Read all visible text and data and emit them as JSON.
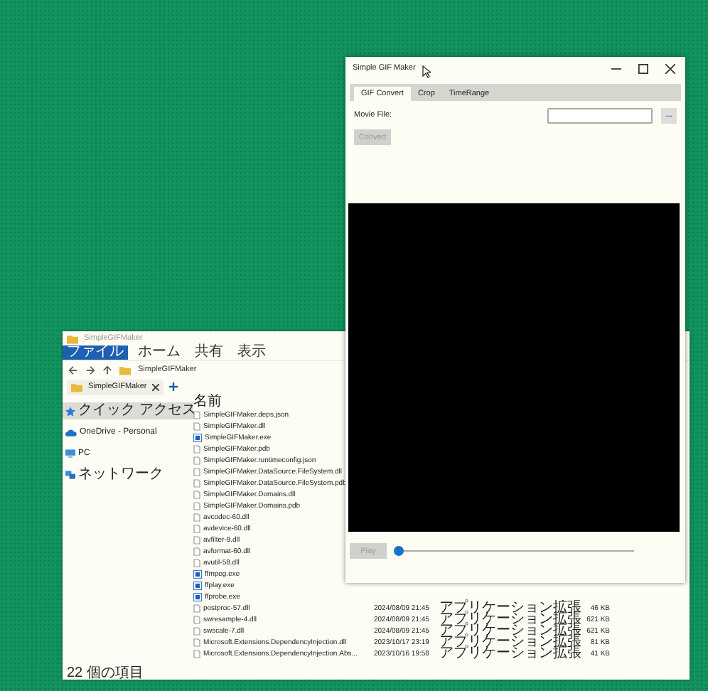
{
  "explorer": {
    "title": "SimpleGIFMaker",
    "ribbon_tabs": [
      {
        "label": "ファイル",
        "selected": true
      },
      {
        "label": "ホーム",
        "selected": false
      },
      {
        "label": "共有",
        "selected": false
      },
      {
        "label": "表示",
        "selected": false
      }
    ],
    "breadcrumb": "SimpleGIFMaker",
    "tab": "SimpleGIFMaker",
    "nav_items": [
      {
        "label": "クイック アクセス",
        "kind": "star",
        "selected": true
      },
      {
        "label": "OneDrive - Personal",
        "kind": "cloud",
        "selected": false
      },
      {
        "label": "PC",
        "kind": "pc",
        "selected": false
      },
      {
        "label": "ネットワーク",
        "kind": "network",
        "selected": false
      }
    ],
    "column_name": "名前",
    "files": [
      {
        "name": "SimpleGIFMaker.deps.json",
        "kind": "file"
      },
      {
        "name": "SimpleGIFMaker.dll",
        "kind": "file"
      },
      {
        "name": "SimpleGIFMaker.exe",
        "kind": "exe"
      },
      {
        "name": "SimpleGIFMaker.pdb",
        "kind": "file"
      },
      {
        "name": "SimpleGIFMaker.runtimeconfig.json",
        "kind": "file"
      },
      {
        "name": "SimpleGIFMaker.DataSource.FileSystem.dll",
        "kind": "file"
      },
      {
        "name": "SimpleGIFMaker.DataSource.FileSystem.pdb",
        "kind": "file"
      },
      {
        "name": "SimpleGIFMaker.Domains.dll",
        "kind": "file"
      },
      {
        "name": "SimpleGIFMaker.Domains.pdb",
        "kind": "file"
      },
      {
        "name": "avcodec-60.dll",
        "kind": "file"
      },
      {
        "name": "avdevice-60.dll",
        "kind": "file"
      },
      {
        "name": "avfilter-9.dll",
        "kind": "file"
      },
      {
        "name": "avformat-60.dll",
        "kind": "file"
      },
      {
        "name": "avutil-58.dll",
        "kind": "file"
      },
      {
        "name": "ffmpeg.exe",
        "kind": "exe"
      },
      {
        "name": "ffplay.exe",
        "kind": "exe"
      },
      {
        "name": "ffprobe.exe",
        "kind": "exe"
      },
      {
        "name": "postproc-57.dll",
        "kind": "file",
        "date": "2024/08/09 21:45",
        "type": "アプリケーション拡張",
        "size": "46 KB"
      },
      {
        "name": "swresample-4.dll",
        "kind": "file",
        "date": "2024/08/09 21:45",
        "type": "アプリケーション拡張",
        "size": "621 KB"
      },
      {
        "name": "swscale-7.dll",
        "kind": "file",
        "date": "2024/08/09 21:45",
        "type": "アプリケーション拡張",
        "size": "621 KB"
      },
      {
        "name": "Microsoft.Extensions.DependencyInjection.dll",
        "kind": "file",
        "date": "2023/10/17 23:19",
        "type": "アプリケーション拡張",
        "size": "81 KB"
      },
      {
        "name": "Microsoft.Extensions.DependencyInjection.Abs...",
        "kind": "file",
        "date": "2023/10/16 19:58",
        "type": "アプリケーション拡張",
        "size": "41 KB"
      }
    ],
    "status": "22 個の項目"
  },
  "gif_window": {
    "title": "Simple GIF Maker",
    "tabs": [
      {
        "label": "GIF Convert",
        "selected": true
      },
      {
        "label": "Crop",
        "selected": false
      },
      {
        "label": "TimeRange",
        "selected": false
      }
    ],
    "movie_file_label": "Movie File:",
    "browse_button": "...",
    "convert_button": {
      "label": "Convert",
      "disabled": true
    },
    "play_button": {
      "label": "Play",
      "disabled": true
    },
    "seek_slider": {
      "level": 0
    }
  }
}
